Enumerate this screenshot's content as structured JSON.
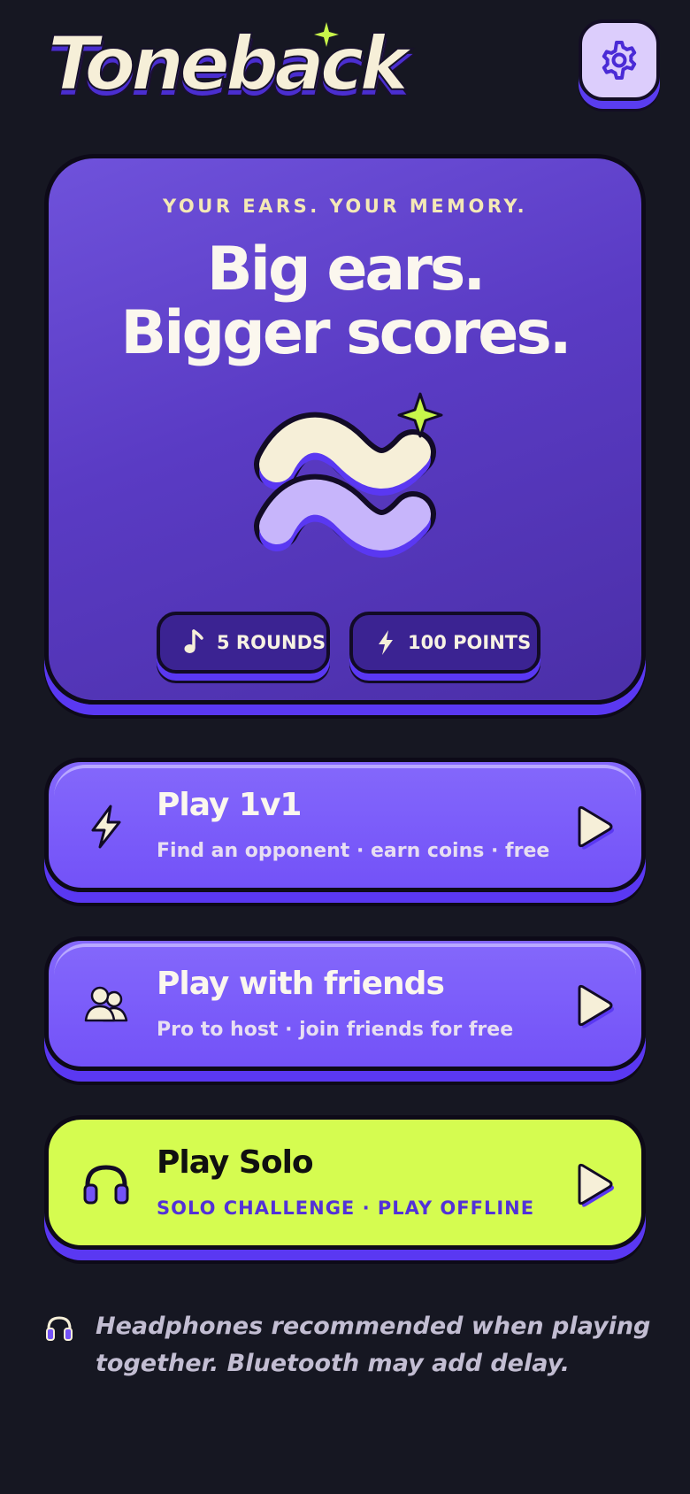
{
  "header": {
    "logo_text": "Toneback",
    "settings_icon": "gear-icon"
  },
  "hero": {
    "eyebrow": "YOUR EARS. YOUR MEMORY.",
    "headline_line1": "Big ears.",
    "headline_line2": "Bigger scores.",
    "art_icon": "sound-waves-icon",
    "pills": [
      {
        "icon": "music-note-icon",
        "label": "5 ROUNDS"
      },
      {
        "icon": "lightning-icon",
        "label": "100 POINTS"
      }
    ]
  },
  "modes": [
    {
      "icon": "lightning-icon",
      "title": "Play 1v1",
      "subtitle": "Find an opponent · earn coins · free",
      "color": "#7352f8"
    },
    {
      "icon": "friends-icon",
      "title": "Play with friends",
      "subtitle": "Pro to host · join friends for free",
      "color": "#7352f8"
    },
    {
      "icon": "headphones-icon",
      "title": "Play Solo",
      "subtitle": "SOLO CHALLENGE · PLAY OFFLINE",
      "color": "#d5fc50"
    }
  ],
  "footnote": {
    "icon": "headphones-icon",
    "text": "Headphones recommended when playing together. Bluetooth may add delay."
  },
  "colors": {
    "background": "#161722",
    "accent_purple": "#5a38f2",
    "accent_lime": "#d5fc50",
    "cream": "#f6efd8"
  }
}
